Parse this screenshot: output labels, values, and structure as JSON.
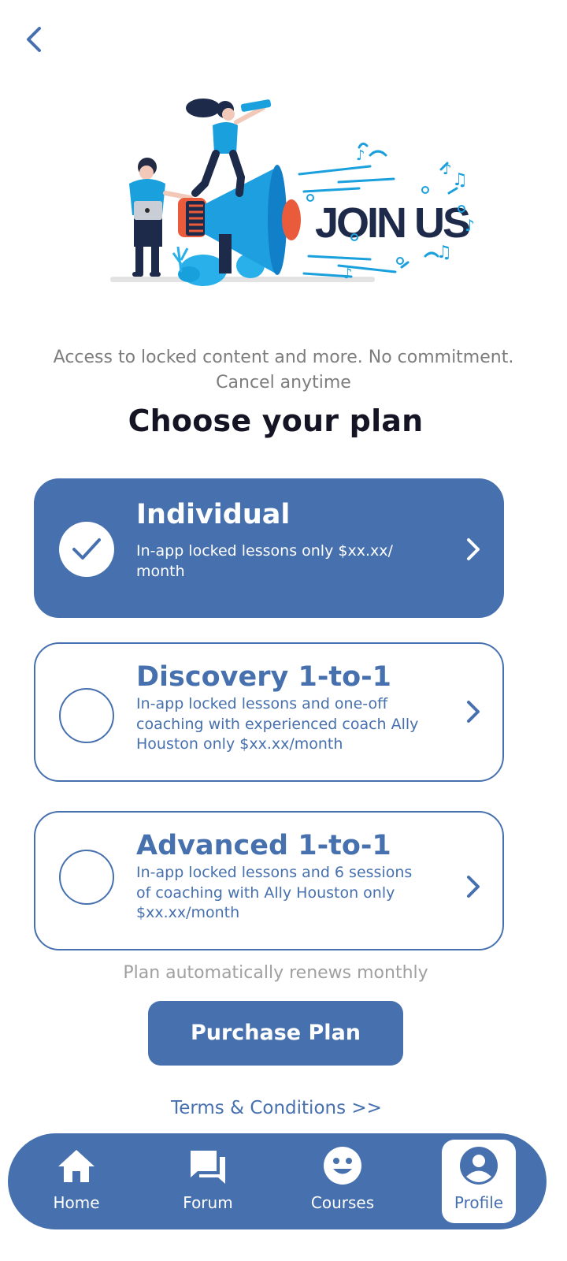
{
  "header": {
    "back_icon": "chevron-left-icon"
  },
  "hero": {
    "banner_text": "JOIN US"
  },
  "intro": {
    "subtitle_line1": "Access to locked content and more. No commitment.",
    "subtitle_line2": "Cancel anytime",
    "title": "Choose your plan"
  },
  "plans": [
    {
      "name": "Individual",
      "description": "In-app locked lessons only $xx.xx/ month",
      "selected": true
    },
    {
      "name": "Discovery 1-to-1",
      "description": "In-app locked lessons and one-off coaching with experienced coach Ally Houston only $xx.xx/month",
      "selected": false
    },
    {
      "name": "Advanced 1-to-1",
      "description": "In-app locked lessons and 6 sessions of coaching with Ally Houston only $xx.xx/month",
      "selected": false
    }
  ],
  "renew_note": "Plan automatically renews monthly",
  "purchase_label": "Purchase Plan",
  "terms_label": "Terms & Conditions >>",
  "nav": [
    {
      "label": "Home",
      "icon": "home-icon",
      "active": false
    },
    {
      "label": "Forum",
      "icon": "forum-icon",
      "active": false
    },
    {
      "label": "Courses",
      "icon": "smiley-icon",
      "active": false
    },
    {
      "label": "Profile",
      "icon": "profile-icon",
      "active": true
    }
  ],
  "colors": {
    "accent": "#4670ae",
    "title": "#141424",
    "muted": "#7d7d7d"
  }
}
